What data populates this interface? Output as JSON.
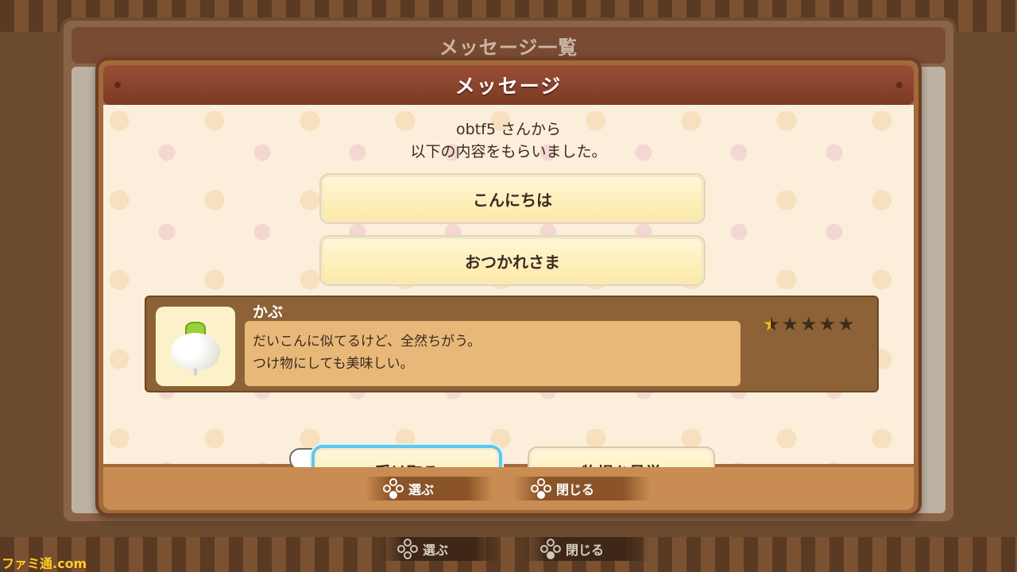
{
  "background": {
    "outer_title": "メッセージ一覧"
  },
  "dialog": {
    "title": "メッセージ",
    "sender_line": "obtf5 さんから",
    "received_line": "以下の内容をもらいました。",
    "messages": [
      "こんにちは",
      "おつかれさま"
    ],
    "item": {
      "name": "かぶ",
      "description_lines": [
        "だいこんに似てるけど、全然ちがう。",
        "つけ物にしても美味しい。"
      ],
      "rating": 0.5,
      "rating_max": 5
    },
    "buttons": {
      "receive": "受け取る",
      "visit": "牧場を見学"
    },
    "hints": {
      "select": "選ぶ",
      "close": "閉じる"
    }
  },
  "global_hints": {
    "select": "選ぶ",
    "close": "閉じる"
  },
  "watermark": "ファミ通.com",
  "colors": {
    "focus_ring": "#5fc8e8",
    "title_bar": "#7c3a25"
  }
}
